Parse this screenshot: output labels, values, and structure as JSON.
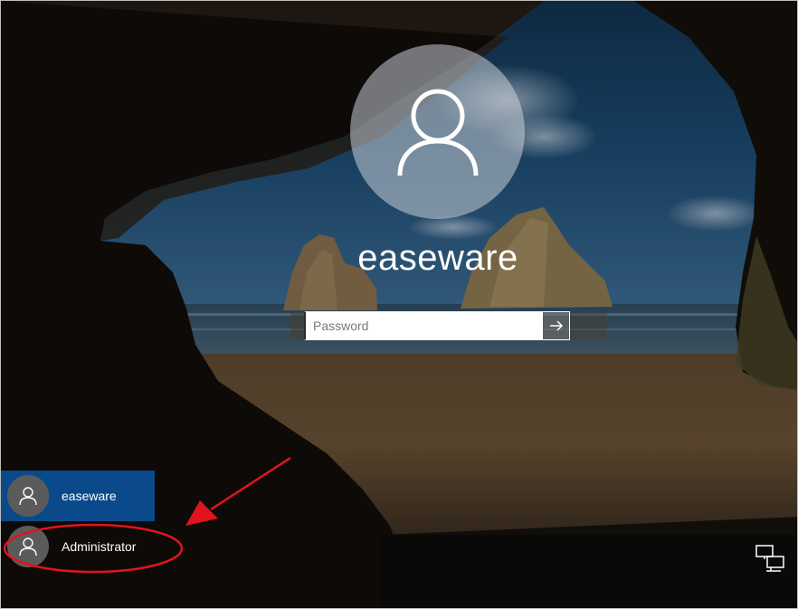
{
  "lockscreen": {
    "username": "easeware",
    "password_placeholder": "Password"
  },
  "user_list": [
    {
      "name": "easeware",
      "selected": true
    },
    {
      "name": "Administrator",
      "selected": false
    }
  ],
  "icons": {
    "big_avatar": "user-silhouette-icon",
    "submit": "arrow-right-icon",
    "network": "network-icon"
  },
  "colors": {
    "selected_user_bg": "#0a4a8a",
    "annotation_red": "#e0141e"
  }
}
